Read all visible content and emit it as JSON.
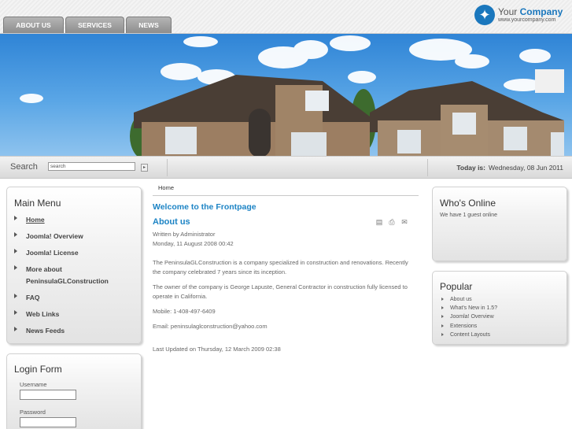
{
  "nav": {
    "tabs": [
      "ABOUT US",
      "SERVICES",
      "NEWS"
    ]
  },
  "logo": {
    "name_part1": "Your",
    "name_part2": "Company",
    "url": "www.yourcompany.com"
  },
  "search": {
    "label": "Search",
    "value": "search",
    "button_glyph": "▸"
  },
  "date": {
    "label": "Today is:",
    "value": "Wednesday, 08 Jun 2011"
  },
  "main_menu": {
    "title": "Main Menu",
    "items": [
      {
        "label": "Home",
        "active": true
      },
      {
        "label": "Joomla! Overview"
      },
      {
        "label": "Joomla! License"
      },
      {
        "label": "More about PeninsulaGLConstruction"
      },
      {
        "label": "FAQ"
      },
      {
        "label": "Web Links"
      },
      {
        "label": "News Feeds"
      }
    ]
  },
  "login": {
    "title": "Login Form",
    "username_label": "Username",
    "password_label": "Password"
  },
  "whos_online": {
    "title": "Who's Online",
    "text": "We have 1 guest online"
  },
  "popular": {
    "title": "Popular",
    "items": [
      "About us",
      "What's New in 1.5?",
      "Joomla! Overview",
      "Extensions",
      "Content Layouts"
    ]
  },
  "content": {
    "breadcrumb": "Home",
    "page_title": "Welcome to the Frontpage",
    "article_title": "About us",
    "author": "Written by Administrator",
    "date": "Monday, 11 August 2008 00:42",
    "paragraphs": [
      "The PeninsulaGLConstruction is a company specialized in construction and renovations. Recently the company celebrated 7 years since its inception.",
      "The owner of the company is George Lapuste, General Contractor in construction fully licensed to operate in California.",
      "Mobile: 1-408-497-6409",
      "Email: peninsulaglconstruction@yahoo.com"
    ],
    "last_updated": "Last Updated on Thursday, 12 March 2009 02:38"
  },
  "icons": {
    "pdf": "pdf-icon",
    "print": "print-icon",
    "email": "email-icon"
  },
  "colors": {
    "accent": "#1d84c5",
    "tab": "#9b9b9b"
  }
}
